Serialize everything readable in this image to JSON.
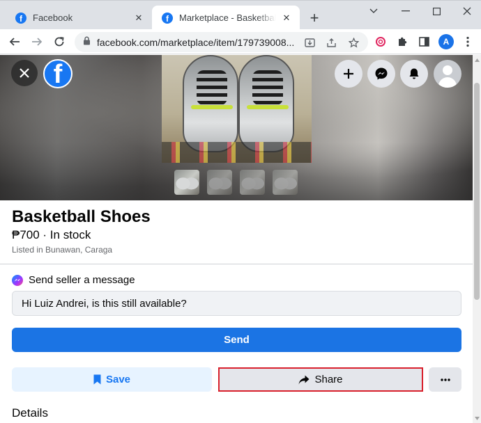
{
  "browser": {
    "tabs": [
      {
        "title": "Facebook",
        "active": false
      },
      {
        "title": "Marketplace - Basketball Shoes",
        "active": true
      }
    ],
    "url": "facebook.com/marketplace/item/179739008..."
  },
  "hero": {
    "brand_letter": "f",
    "avatar_initial": "A",
    "thumbnails": 4
  },
  "listing": {
    "title": "Basketball Shoes",
    "price_line": "₱700 · In stock",
    "location": "Listed in Bunawan, Caraga"
  },
  "message": {
    "heading": "Send seller a message",
    "input_value": "Hi Luiz Andrei, is this still available?",
    "send_label": "Send"
  },
  "actions": {
    "save_label": "Save",
    "share_label": "Share",
    "more_label": "···"
  },
  "details_heading": "Details",
  "colors": {
    "brand": "#1877f2",
    "send_button": "#1b74e4",
    "highlight_border": "#d9202c"
  }
}
